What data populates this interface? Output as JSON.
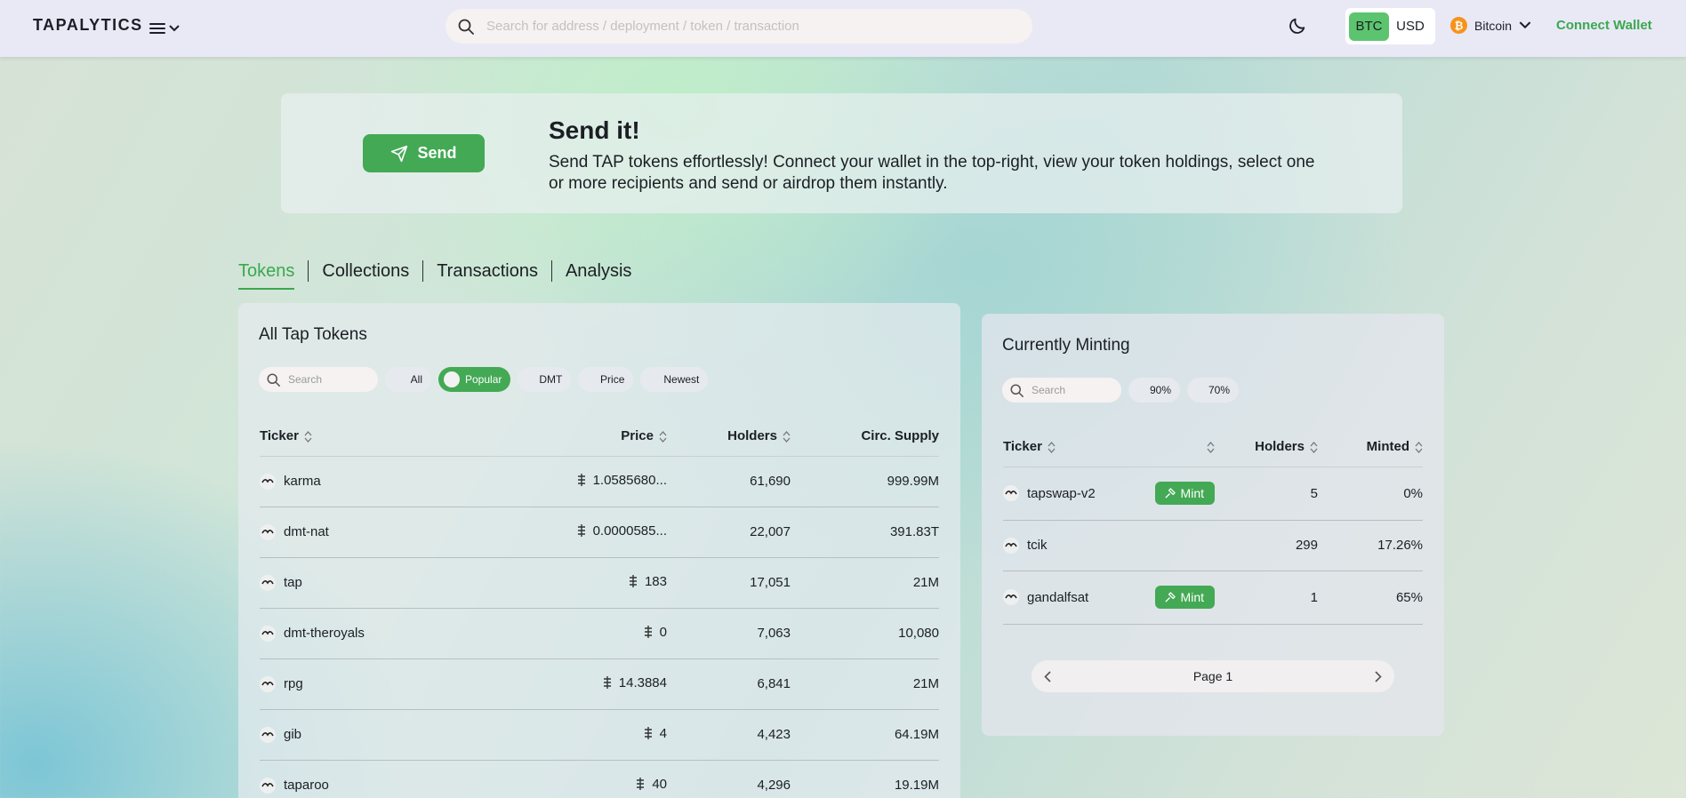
{
  "header": {
    "logo": "TAPALYTICS",
    "search_placeholder": "Search for address / deployment / token / transaction",
    "currency": {
      "btc": "BTC",
      "usd": "USD",
      "active": "BTC"
    },
    "network": "Bitcoin",
    "connect_wallet": "Connect Wallet"
  },
  "banner": {
    "send_label": "Send",
    "title": "Send it!",
    "text": "Send TAP tokens effortlessly! Connect your wallet in the top-right, view your token holdings, select one or more recipients and send or airdrop them instantly."
  },
  "tabs": [
    "Tokens",
    "Collections",
    "Transactions",
    "Analysis"
  ],
  "active_tab": "Tokens",
  "tokens_panel": {
    "title": "All Tap Tokens",
    "search_placeholder": "Search",
    "filters": [
      "All",
      "Popular",
      "DMT",
      "Price",
      "Newest"
    ],
    "active_filter": "Popular",
    "columns": [
      "Ticker",
      "Price",
      "Holders",
      "Circ. Supply"
    ],
    "rows": [
      {
        "ticker": "karma",
        "price": "1.0585680...",
        "holders": "61,690",
        "supply": "999.99M"
      },
      {
        "ticker": "dmt-nat",
        "price": "0.0000585...",
        "holders": "22,007",
        "supply": "391.83T"
      },
      {
        "ticker": "tap",
        "price": "183",
        "holders": "17,051",
        "supply": "21M"
      },
      {
        "ticker": "dmt-theroyals",
        "price": "0",
        "holders": "7,063",
        "supply": "10,080"
      },
      {
        "ticker": "rpg",
        "price": "14.3884",
        "holders": "6,841",
        "supply": "21M"
      },
      {
        "ticker": "gib",
        "price": "4",
        "holders": "4,423",
        "supply": "64.19M"
      },
      {
        "ticker": "taparoo",
        "price": "40",
        "holders": "4,296",
        "supply": "19.19M"
      }
    ]
  },
  "minting_panel": {
    "title": "Currently Minting",
    "search_placeholder": "Search",
    "filters": [
      "90%",
      "70%"
    ],
    "columns": [
      "Ticker",
      "",
      "Holders",
      "Minted"
    ],
    "mint_label": "Mint",
    "rows": [
      {
        "ticker": "tapswap-v2",
        "mint": true,
        "holders": "5",
        "minted": "0%"
      },
      {
        "ticker": "tcik",
        "mint": false,
        "holders": "299",
        "minted": "17.26%"
      },
      {
        "ticker": "gandalfsat",
        "mint": true,
        "holders": "1",
        "minted": "65%"
      }
    ],
    "page_label": "Page 1"
  },
  "colors": {
    "accent": "#43a954",
    "header_bg": "#e9e9f6"
  }
}
